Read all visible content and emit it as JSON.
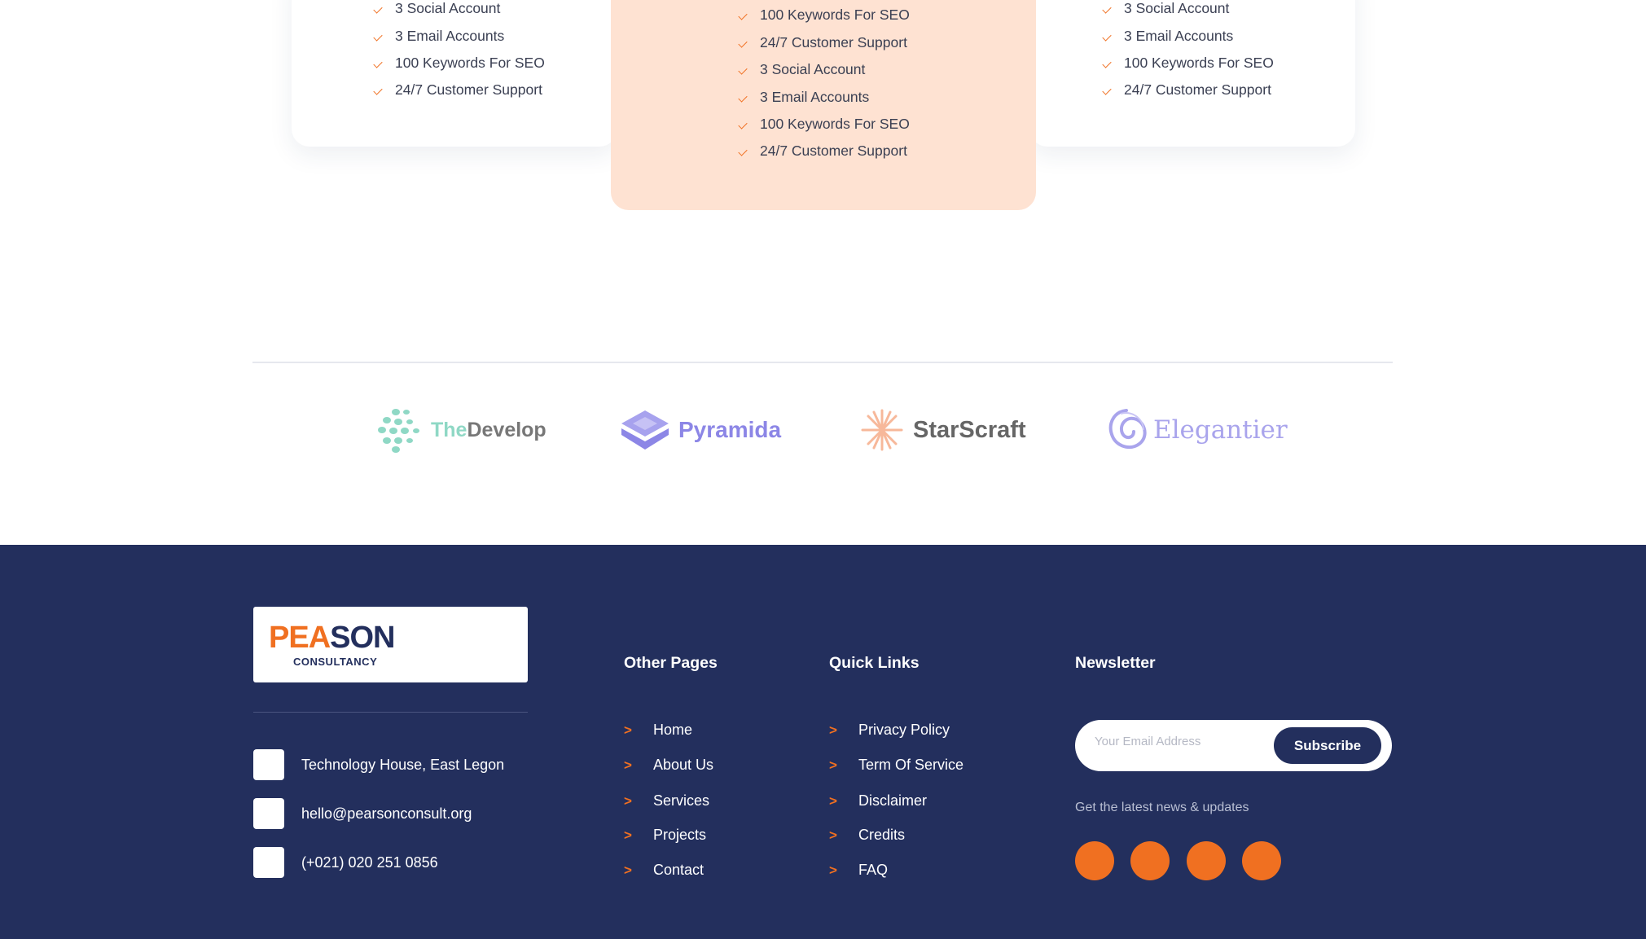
{
  "pricing": {
    "left_card": {
      "features": [
        "3 Social Account",
        "3 Email Accounts",
        "100 Keywords For SEO",
        "24/7 Customer Support"
      ]
    },
    "middle_card": {
      "features": [
        "100 Keywords For SEO",
        "24/7 Customer Support",
        "3 Social Account",
        "3 Email Accounts",
        "100 Keywords For SEO",
        "24/7 Customer Support"
      ]
    },
    "right_card": {
      "features": [
        "3 Social Account",
        "3 Email Accounts",
        "100 Keywords For SEO",
        "24/7 Customer Support"
      ]
    }
  },
  "brands": [
    {
      "prefix": "The",
      "name": "Develop",
      "icon": "dots-icon",
      "color": "#8fd8c5",
      "text_color": "#777777"
    },
    {
      "name": "Pyramida",
      "icon": "layers-icon",
      "color": "#8c86e6"
    },
    {
      "name": "StarScraft",
      "icon": "star-burst-icon",
      "color": "#f7b89a",
      "text_color": "#666666"
    },
    {
      "name": "Elegantier",
      "icon": "swirl-icon",
      "color": "#a9a4ec"
    }
  ],
  "footer": {
    "logo": {
      "main_orange": "PE",
      "main_mark": "A",
      "main_navy": "SON",
      "sub": "CONSULTANCY"
    },
    "contacts": [
      {
        "icon": "location-icon",
        "text": "Technology House, East Legon"
      },
      {
        "icon": "mail-icon",
        "text": "hello@pearsonconsult.org"
      },
      {
        "icon": "phone-icon",
        "text": "(+021) 020 251 0856"
      }
    ],
    "other_pages": {
      "title": "Other Pages",
      "links": [
        "Home",
        "About Us",
        "Services",
        "Projects",
        "Contact"
      ]
    },
    "quick_links": {
      "title": "Quick Links",
      "links": [
        "Privacy Policy",
        "Term Of Service",
        "Disclaimer",
        "Credits",
        "FAQ"
      ]
    },
    "newsletter": {
      "title": "Newsletter",
      "placeholder": "Your Email Address",
      "button": "Subscribe",
      "caption": "Get the latest news & updates"
    },
    "socials": [
      "facebook-icon",
      "twitter-icon",
      "instagram-icon",
      "linkedin-icon"
    ]
  },
  "colors": {
    "accent": "#f07021",
    "navy": "#232f5d",
    "highlight_card": "#fee2d2"
  }
}
